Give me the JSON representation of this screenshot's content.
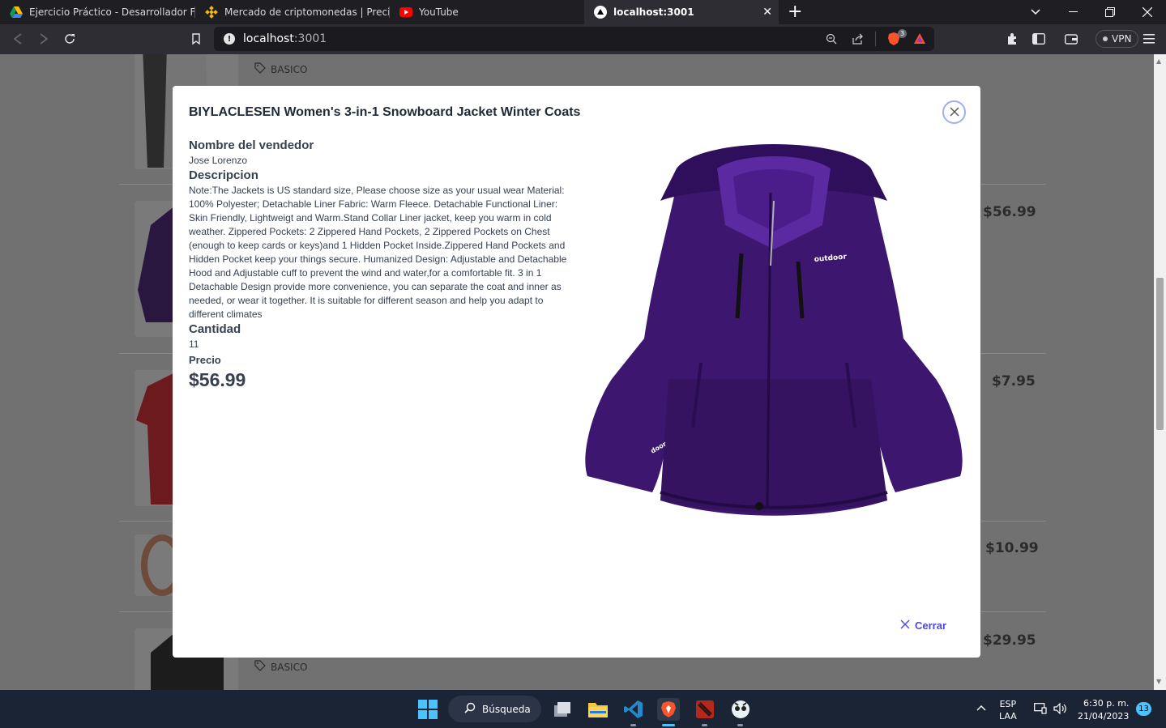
{
  "tabs": [
    {
      "title": "Ejercicio Práctico - Desarrollador Full-s",
      "icon": "google-drive-icon"
    },
    {
      "title": "Mercado de criptomonedas | Precios y",
      "icon": "binance-icon"
    },
    {
      "title": "YouTube",
      "icon": "youtube-icon"
    },
    {
      "title": "localhost:3001",
      "icon": "vercel-triangle-icon"
    }
  ],
  "address": {
    "host": "localhost",
    "port": ":3001"
  },
  "vpn_label": "VPN",
  "brave_badge": "3",
  "background": {
    "tag_label": "BASICO",
    "prices": [
      "$56.99",
      "$7.95",
      "$10.99",
      "$29.95"
    ]
  },
  "modal": {
    "title": "BIYLACLESEN Women's 3-in-1 Snowboard Jacket Winter Coats",
    "seller_label": "Nombre del vendedor",
    "seller": "Jose Lorenzo",
    "description_label": "Descripcion",
    "description": "Note:The Jackets is US standard size, Please choose size as your usual wear Material: 100% Polyester; Detachable Liner Fabric: Warm Fleece. Detachable Functional Liner: Skin Friendly, Lightweigt and Warm.Stand Collar Liner jacket, keep you warm in cold weather. Zippered Pockets: 2 Zippered Hand Pockets, 2 Zippered Pockets on Chest (enough to keep cards or keys)and 1 Hidden Pocket Inside.Zippered Hand Pockets and Hidden Pocket keep your things secure. Humanized Design: Adjustable and Detachable Hood and Adjustable cuff to prevent the wind and water,for a comfortable fit. 3 in 1 Detachable Design provide more convenience, you can separate the coat and inner as needed, or wear it together. It is suitable for different season and help you adapt to different climates",
    "quantity_label": "Cantidad",
    "quantity": "11",
    "price_label": "Precio",
    "price": "$56.99",
    "close_label": "Cerrar",
    "jacket_brand": "outdoor",
    "jacket_cuff_text": "door"
  },
  "taskbar": {
    "search_label": "Búsqueda",
    "lang_top": "ESP",
    "lang_bottom": "LAA",
    "time": "6:30 p. m.",
    "date": "21/04/2023",
    "notifications": "13"
  }
}
